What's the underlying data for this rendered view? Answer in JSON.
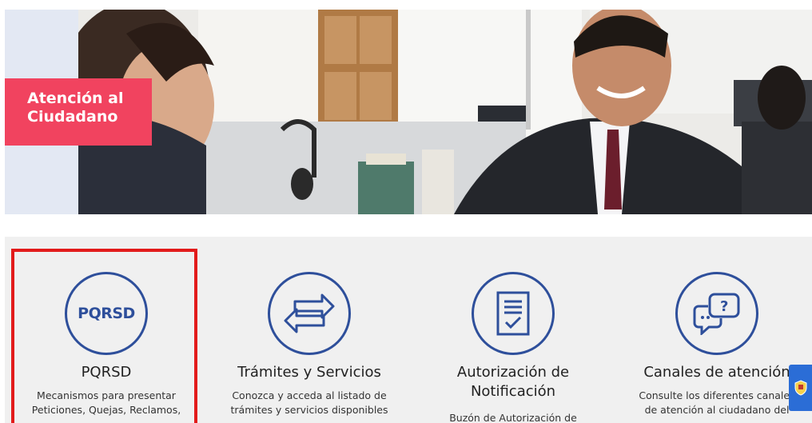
{
  "hero": {
    "badge_line1": "Atención al",
    "badge_line2": "Ciudadano"
  },
  "cards": [
    {
      "icon": "pqrsd-icon",
      "icon_text": "PQRSD",
      "title": "PQRSD",
      "desc_line1": "Mecanismos para presentar",
      "desc_line2": "Peticiones, Quejas, Reclamos,"
    },
    {
      "icon": "exchange-arrows-icon",
      "title": "Trámites y Servicios",
      "desc_line1": "Conozca y acceda al listado de",
      "desc_line2": "trámites y servicios disponibles"
    },
    {
      "icon": "document-check-icon",
      "title_line1": "Autorización de",
      "title_line2": "Notificación",
      "desc_line1": "Buzón de Autorización de"
    },
    {
      "icon": "chat-question-icon",
      "title": "Canales de atención",
      "desc_line1": "Consulte los diferentes canales",
      "desc_line2": "de atención al ciudadano del"
    }
  ],
  "colors": {
    "accent_blue": "#2e4f9b",
    "badge_pink": "#f1435f",
    "highlight_red": "#e21b1b",
    "strip_bg": "#f0f0f0"
  }
}
